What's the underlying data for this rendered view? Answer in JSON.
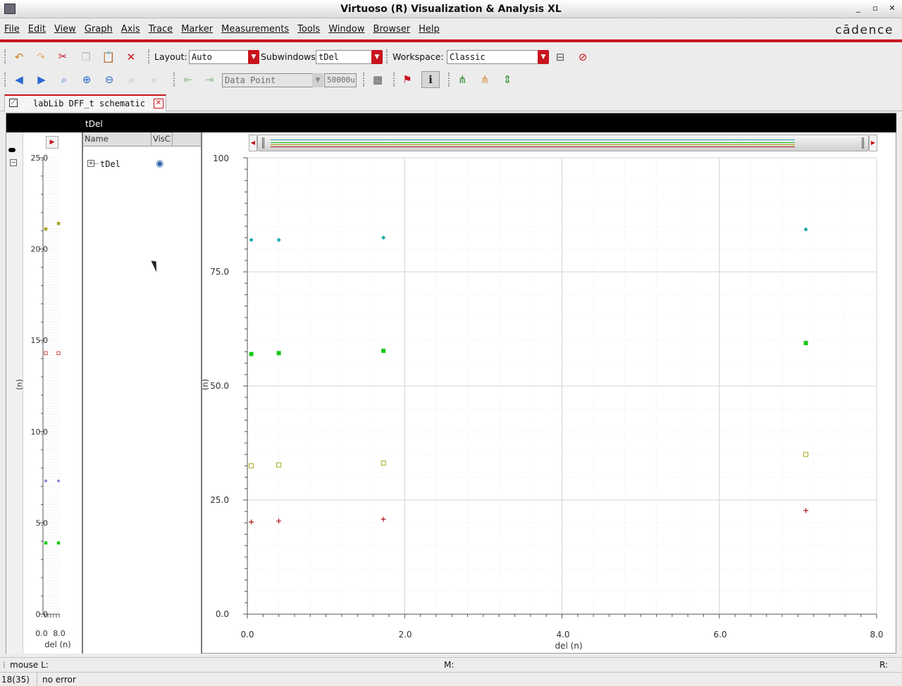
{
  "window": {
    "title": "Virtuoso (R) Visualization & Analysis XL",
    "controls": {
      "minimize": "_",
      "maximize": "▫",
      "close": "✕"
    }
  },
  "menubar": {
    "items": [
      "File",
      "Edit",
      "View",
      "Graph",
      "Axis",
      "Trace",
      "Marker",
      "Measurements",
      "Tools",
      "Window",
      "Browser",
      "Help"
    ],
    "brand": "cādence"
  },
  "toolbar1": {
    "layout_label": "Layout:",
    "layout_value": "Auto",
    "subwindows_label": "Subwindows:",
    "subwindows_value": "tDel",
    "workspace_label": "Workspace:",
    "workspace_value": "Classic"
  },
  "toolbar2": {
    "marker_mode": "Data Point",
    "marker_value": "50000u"
  },
  "tab": {
    "label": "labLib DFF_t schematic"
  },
  "subwindow": {
    "name": "tDel"
  },
  "browser": {
    "columns": [
      "Name",
      "VisC"
    ],
    "items": [
      {
        "name": "tDel"
      }
    ]
  },
  "colors": {
    "accent": "#c8141e",
    "teal": "#18a8a8",
    "green": "#18c818",
    "olive": "#a8a418",
    "red": "#b01818"
  },
  "main_chart": {
    "x_ticks": [
      "0.0",
      "2.0",
      "4.0",
      "6.0",
      "8.0"
    ],
    "y_ticks": [
      "0.0",
      "25.0",
      "50.0",
      "75.0",
      "100"
    ],
    "xlabel": "del (n)",
    "ylabel": "(n)"
  },
  "mini_chart": {
    "y_ticks": [
      "0.0",
      "5.0",
      "10.0",
      "15.0",
      "20.0",
      "25.0"
    ],
    "x_tick_left": "0.0",
    "x_tick_right": "8.0",
    "xlabel": "del (n)",
    "ylabel": "(n)"
  },
  "chart_data": [
    {
      "type": "scatter",
      "xlabel": "del (n)",
      "ylabel": "(n)",
      "xlim": [
        0,
        8
      ],
      "ylim": [
        0,
        100
      ],
      "grid": true,
      "series": [
        {
          "marker": "diamond",
          "color": "#18a8a8",
          "x": [
            0.05,
            0.4,
            1.73,
            7.1
          ],
          "y": [
            82.0,
            82.0,
            82.5,
            84.3
          ]
        },
        {
          "marker": "filled-square",
          "color": "#18c818",
          "x": [
            0.05,
            0.4,
            1.73,
            7.1
          ],
          "y": [
            57.0,
            57.2,
            57.7,
            59.4
          ]
        },
        {
          "marker": "open-square",
          "color": "#a8a418",
          "x": [
            0.05,
            0.4,
            1.73,
            7.1
          ],
          "y": [
            32.5,
            32.7,
            33.1,
            35.0
          ]
        },
        {
          "marker": "plus",
          "color": "#b01818",
          "x": [
            0.05,
            0.4,
            1.73,
            7.1
          ],
          "y": [
            20.2,
            20.4,
            20.8,
            22.7
          ]
        }
      ]
    },
    {
      "type": "scatter",
      "xlabel": "del (n)",
      "ylabel": "(n)",
      "ylim": [
        0,
        25
      ],
      "grid": true,
      "series": [
        {
          "marker": "filled-square",
          "color": "#a8a418",
          "x": [
            0.0,
            8.0
          ],
          "y": [
            21.1,
            21.4
          ]
        },
        {
          "marker": "open-square",
          "color": "#d05050",
          "x": [
            0.0,
            8.0
          ],
          "y": [
            14.3,
            14.3
          ]
        },
        {
          "marker": "plus",
          "color": "#6060d0",
          "x": [
            0.0,
            8.0
          ],
          "y": [
            7.3,
            7.3
          ]
        },
        {
          "marker": "filled-square",
          "color": "#18c818",
          "x": [
            0.0,
            8.0
          ],
          "y": [
            3.9,
            3.9
          ]
        }
      ]
    }
  ]
}
